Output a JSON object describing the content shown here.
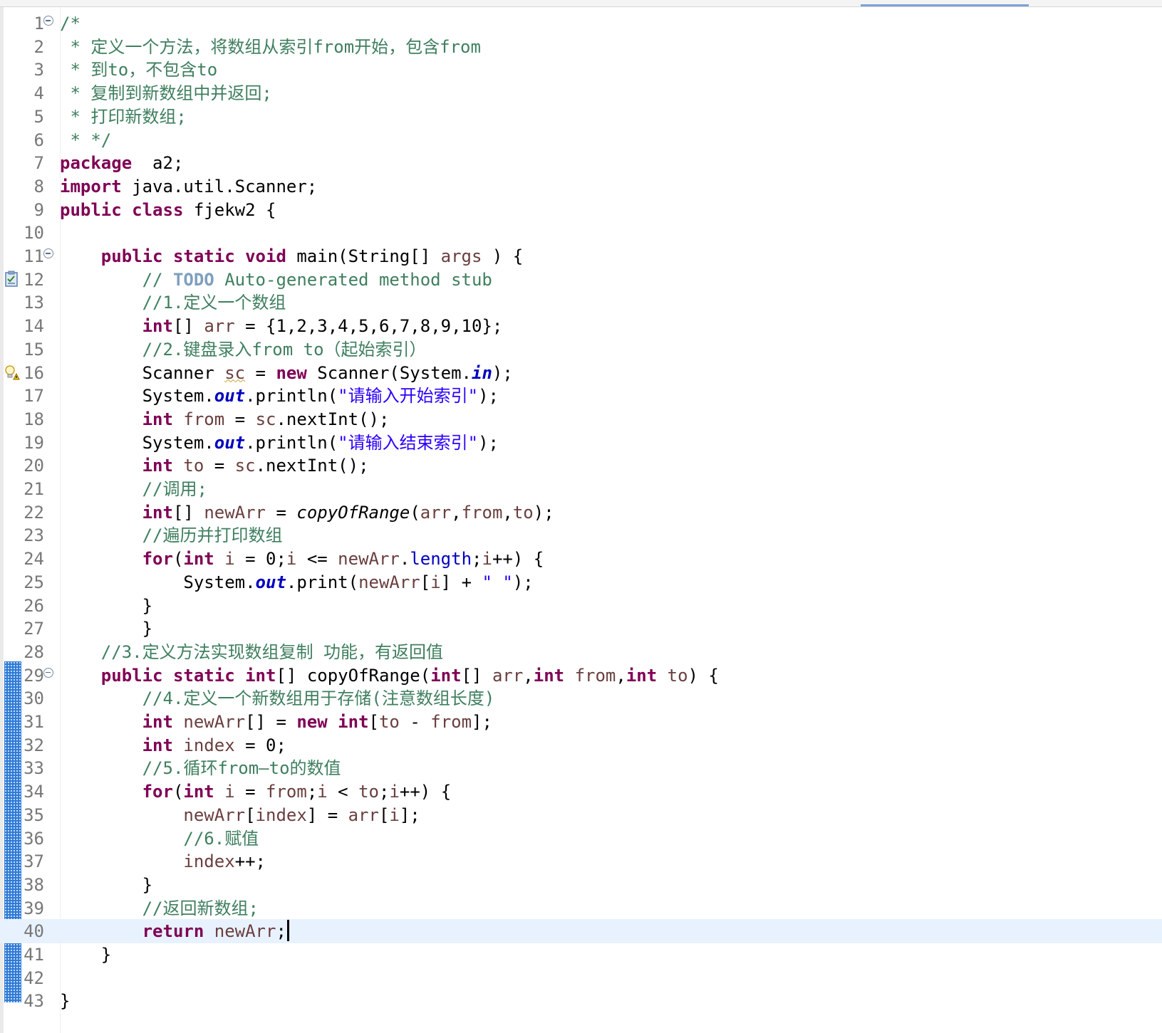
{
  "editor": {
    "lines": [
      {
        "n": "1",
        "fold": true,
        "segs": [
          [
            "cm",
            "/*"
          ]
        ]
      },
      {
        "n": "2",
        "segs": [
          [
            "cm",
            " * 定义一个方法，将数组从索引from开始，包含from"
          ]
        ]
      },
      {
        "n": "3",
        "segs": [
          [
            "cm",
            " * 到to，不包含to"
          ]
        ]
      },
      {
        "n": "4",
        "segs": [
          [
            "cm",
            " * 复制到新数组中并返回;"
          ]
        ]
      },
      {
        "n": "5",
        "segs": [
          [
            "cm",
            " * 打印新数组;"
          ]
        ]
      },
      {
        "n": "6",
        "segs": [
          [
            "cm",
            " * */"
          ]
        ]
      },
      {
        "n": "7",
        "segs": [
          [
            "kw",
            "package"
          ],
          [
            "",
            "  a2;"
          ]
        ]
      },
      {
        "n": "8",
        "segs": [
          [
            "kw",
            "import"
          ],
          [
            "",
            " java.util.Scanner;"
          ]
        ]
      },
      {
        "n": "9",
        "segs": [
          [
            "kw",
            "public"
          ],
          [
            "",
            " "
          ],
          [
            "kw",
            "class"
          ],
          [
            "",
            " fjekw2 {"
          ]
        ]
      },
      {
        "n": "10",
        "segs": []
      },
      {
        "n": "11",
        "fold": true,
        "segs": [
          [
            "",
            "    "
          ],
          [
            "kw",
            "public"
          ],
          [
            "",
            " "
          ],
          [
            "kw",
            "static"
          ],
          [
            "",
            " "
          ],
          [
            "kw",
            "void"
          ],
          [
            "",
            " main(String[] "
          ],
          [
            "lv",
            "args"
          ],
          [
            "",
            " ) {"
          ]
        ]
      },
      {
        "n": "12",
        "marker": "task",
        "segs": [
          [
            "",
            "        "
          ],
          [
            "cm",
            "// "
          ],
          [
            "task",
            "TODO"
          ],
          [
            "cm",
            " Auto-generated method stub"
          ]
        ]
      },
      {
        "n": "13",
        "segs": [
          [
            "",
            "        "
          ],
          [
            "cm",
            "//1.定义一个数组"
          ]
        ]
      },
      {
        "n": "14",
        "segs": [
          [
            "",
            "        "
          ],
          [
            "kw",
            "int"
          ],
          [
            "",
            "[] "
          ],
          [
            "lv",
            "arr"
          ],
          [
            "",
            " = {1,2,3,4,5,6,7,8,9,10};"
          ]
        ]
      },
      {
        "n": "15",
        "segs": [
          [
            "",
            "        "
          ],
          [
            "cm",
            "//2.键盘录入from to（起始索引）"
          ]
        ]
      },
      {
        "n": "16",
        "marker": "warning",
        "segs": [
          [
            "",
            "        Scanner "
          ],
          [
            "lvw",
            "sc"
          ],
          [
            "",
            " = "
          ],
          [
            "kw",
            "new"
          ],
          [
            "",
            " Scanner(System."
          ],
          [
            "fld",
            "in"
          ],
          [
            "",
            ");"
          ]
        ]
      },
      {
        "n": "17",
        "segs": [
          [
            "",
            "        System."
          ],
          [
            "fld",
            "out"
          ],
          [
            "",
            ".println("
          ],
          [
            "str",
            "\"请输入开始索引\""
          ],
          [
            "",
            ");"
          ]
        ]
      },
      {
        "n": "18",
        "segs": [
          [
            "",
            "        "
          ],
          [
            "kw",
            "int"
          ],
          [
            "",
            " "
          ],
          [
            "lv",
            "from"
          ],
          [
            "",
            " = "
          ],
          [
            "lv",
            "sc"
          ],
          [
            "",
            ".nextInt();"
          ]
        ]
      },
      {
        "n": "19",
        "segs": [
          [
            "",
            "        System."
          ],
          [
            "fld",
            "out"
          ],
          [
            "",
            ".println("
          ],
          [
            "str",
            "\"请输入结束索引\""
          ],
          [
            "",
            ");"
          ]
        ]
      },
      {
        "n": "20",
        "segs": [
          [
            "",
            "        "
          ],
          [
            "kw",
            "int"
          ],
          [
            "",
            " "
          ],
          [
            "lv",
            "to"
          ],
          [
            "",
            " = "
          ],
          [
            "lv",
            "sc"
          ],
          [
            "",
            ".nextInt();"
          ]
        ]
      },
      {
        "n": "21",
        "segs": [
          [
            "",
            "        "
          ],
          [
            "cm",
            "//调用;"
          ]
        ]
      },
      {
        "n": "22",
        "segs": [
          [
            "",
            "        "
          ],
          [
            "kw",
            "int"
          ],
          [
            "",
            "[] "
          ],
          [
            "lv",
            "newArr"
          ],
          [
            "",
            " = "
          ],
          [
            "it",
            "copyOfRange"
          ],
          [
            "",
            "("
          ],
          [
            "lv",
            "arr"
          ],
          [
            "",
            ","
          ],
          [
            "lv",
            "from"
          ],
          [
            "",
            ","
          ],
          [
            "lv",
            "to"
          ],
          [
            "",
            ");"
          ]
        ]
      },
      {
        "n": "23",
        "segs": [
          [
            "",
            "        "
          ],
          [
            "cm",
            "//遍历并打印数组"
          ]
        ]
      },
      {
        "n": "24",
        "segs": [
          [
            "",
            "        "
          ],
          [
            "kw",
            "for"
          ],
          [
            "",
            "("
          ],
          [
            "kw",
            "int"
          ],
          [
            "",
            " "
          ],
          [
            "lv",
            "i"
          ],
          [
            "",
            " = 0;"
          ],
          [
            "lv",
            "i"
          ],
          [
            "",
            " <= "
          ],
          [
            "lv",
            "newArr"
          ],
          [
            "",
            "."
          ],
          [
            "fldn",
            "length"
          ],
          [
            "",
            ";"
          ],
          [
            "lv",
            "i"
          ],
          [
            "",
            "++) {"
          ]
        ]
      },
      {
        "n": "25",
        "segs": [
          [
            "",
            "            System."
          ],
          [
            "fld",
            "out"
          ],
          [
            "",
            ".print("
          ],
          [
            "lv",
            "newArr"
          ],
          [
            "",
            "["
          ],
          [
            "lv",
            "i"
          ],
          [
            "",
            "] + "
          ],
          [
            "str",
            "\" \""
          ],
          [
            "",
            ");"
          ]
        ]
      },
      {
        "n": "26",
        "segs": [
          [
            "",
            "        }"
          ]
        ]
      },
      {
        "n": "27",
        "segs": [
          [
            "",
            "        }"
          ]
        ]
      },
      {
        "n": "28",
        "segs": [
          [
            "",
            "    "
          ],
          [
            "cm",
            "//3.定义方法实现数组复制 功能，有返回值"
          ]
        ]
      },
      {
        "n": "29",
        "fold": true,
        "segs": [
          [
            "",
            "    "
          ],
          [
            "kw",
            "public"
          ],
          [
            "",
            " "
          ],
          [
            "kw",
            "static"
          ],
          [
            "",
            " "
          ],
          [
            "kw",
            "int"
          ],
          [
            "",
            "[] copyOfRange("
          ],
          [
            "kw",
            "int"
          ],
          [
            "",
            "[] "
          ],
          [
            "lv",
            "arr"
          ],
          [
            "",
            ","
          ],
          [
            "kw",
            "int"
          ],
          [
            "",
            " "
          ],
          [
            "lv",
            "from"
          ],
          [
            "",
            ","
          ],
          [
            "kw",
            "int"
          ],
          [
            "",
            " "
          ],
          [
            "lv",
            "to"
          ],
          [
            "",
            ") {"
          ]
        ]
      },
      {
        "n": "30",
        "segs": [
          [
            "",
            "        "
          ],
          [
            "cm",
            "//4.定义一个新数组用于存储(注意数组长度)"
          ]
        ]
      },
      {
        "n": "31",
        "segs": [
          [
            "",
            "        "
          ],
          [
            "kw",
            "int"
          ],
          [
            "",
            " "
          ],
          [
            "lv",
            "newArr"
          ],
          [
            "",
            "[] = "
          ],
          [
            "kw",
            "new"
          ],
          [
            "",
            " "
          ],
          [
            "kw",
            "int"
          ],
          [
            "",
            "["
          ],
          [
            "lv",
            "to"
          ],
          [
            "",
            " - "
          ],
          [
            "lv",
            "from"
          ],
          [
            "",
            "];"
          ]
        ]
      },
      {
        "n": "32",
        "segs": [
          [
            "",
            "        "
          ],
          [
            "kw",
            "int"
          ],
          [
            "",
            " "
          ],
          [
            "lv",
            "index"
          ],
          [
            "",
            " = 0;"
          ]
        ]
      },
      {
        "n": "33",
        "segs": [
          [
            "",
            "        "
          ],
          [
            "cm",
            "//5.循环from—to的数值"
          ]
        ]
      },
      {
        "n": "34",
        "segs": [
          [
            "",
            "        "
          ],
          [
            "kw",
            "for"
          ],
          [
            "",
            "("
          ],
          [
            "kw",
            "int"
          ],
          [
            "",
            " "
          ],
          [
            "lv",
            "i"
          ],
          [
            "",
            " = "
          ],
          [
            "lv",
            "from"
          ],
          [
            "",
            ";"
          ],
          [
            "lv",
            "i"
          ],
          [
            "",
            " < "
          ],
          [
            "lv",
            "to"
          ],
          [
            "",
            ";"
          ],
          [
            "lv",
            "i"
          ],
          [
            "",
            "++) {"
          ]
        ]
      },
      {
        "n": "35",
        "segs": [
          [
            "",
            "            "
          ],
          [
            "lv",
            "newArr"
          ],
          [
            "",
            "["
          ],
          [
            "lv",
            "index"
          ],
          [
            "",
            "] = "
          ],
          [
            "lv",
            "arr"
          ],
          [
            "",
            "["
          ],
          [
            "lv",
            "i"
          ],
          [
            "",
            "];"
          ]
        ]
      },
      {
        "n": "36",
        "segs": [
          [
            "",
            "            "
          ],
          [
            "cm",
            "//6.赋值"
          ]
        ]
      },
      {
        "n": "37",
        "segs": [
          [
            "",
            "            "
          ],
          [
            "lv",
            "index"
          ],
          [
            "",
            "++;"
          ]
        ]
      },
      {
        "n": "38",
        "segs": [
          [
            "",
            "        }"
          ]
        ]
      },
      {
        "n": "39",
        "segs": [
          [
            "",
            "        "
          ],
          [
            "cm",
            "//返回新数组;"
          ]
        ]
      },
      {
        "n": "40",
        "current": true,
        "segs": [
          [
            "",
            "        "
          ],
          [
            "kw",
            "return"
          ],
          [
            "",
            " "
          ],
          [
            "lv",
            "newArr"
          ],
          [
            "",
            ";"
          ]
        ]
      },
      {
        "n": "41",
        "segs": [
          [
            "",
            "    }"
          ]
        ]
      },
      {
        "n": "42",
        "segs": []
      },
      {
        "n": "43",
        "segs": [
          [
            "",
            "}"
          ]
        ]
      }
    ],
    "colors": {
      "keyword": "#7f0055",
      "comment": "#3f7f5f",
      "string": "#2a00ff",
      "static_field": "#0000c0",
      "local_var": "#6a3e3e",
      "current_line": "#e8f2fe",
      "diff_bar": "#2f7bd6"
    },
    "icons": {
      "task_marker": "task-icon",
      "warning_marker": "warning-bulb-icon",
      "fold": "collapse-minus-icon"
    }
  }
}
